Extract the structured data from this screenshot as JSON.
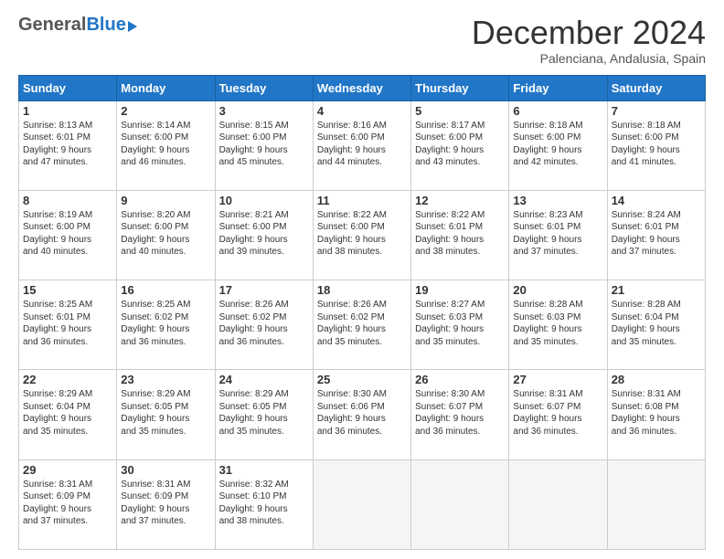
{
  "header": {
    "logo_general": "General",
    "logo_blue": "Blue",
    "title": "December 2024",
    "location": "Palenciana, Andalusia, Spain"
  },
  "days_of_week": [
    "Sunday",
    "Monday",
    "Tuesday",
    "Wednesday",
    "Thursday",
    "Friday",
    "Saturday"
  ],
  "weeks": [
    [
      {
        "day": "1",
        "lines": [
          "Sunrise: 8:13 AM",
          "Sunset: 6:01 PM",
          "Daylight: 9 hours",
          "and 47 minutes."
        ]
      },
      {
        "day": "2",
        "lines": [
          "Sunrise: 8:14 AM",
          "Sunset: 6:00 PM",
          "Daylight: 9 hours",
          "and 46 minutes."
        ]
      },
      {
        "day": "3",
        "lines": [
          "Sunrise: 8:15 AM",
          "Sunset: 6:00 PM",
          "Daylight: 9 hours",
          "and 45 minutes."
        ]
      },
      {
        "day": "4",
        "lines": [
          "Sunrise: 8:16 AM",
          "Sunset: 6:00 PM",
          "Daylight: 9 hours",
          "and 44 minutes."
        ]
      },
      {
        "day": "5",
        "lines": [
          "Sunrise: 8:17 AM",
          "Sunset: 6:00 PM",
          "Daylight: 9 hours",
          "and 43 minutes."
        ]
      },
      {
        "day": "6",
        "lines": [
          "Sunrise: 8:18 AM",
          "Sunset: 6:00 PM",
          "Daylight: 9 hours",
          "and 42 minutes."
        ]
      },
      {
        "day": "7",
        "lines": [
          "Sunrise: 8:18 AM",
          "Sunset: 6:00 PM",
          "Daylight: 9 hours",
          "and 41 minutes."
        ]
      }
    ],
    [
      {
        "day": "8",
        "lines": [
          "Sunrise: 8:19 AM",
          "Sunset: 6:00 PM",
          "Daylight: 9 hours",
          "and 40 minutes."
        ]
      },
      {
        "day": "9",
        "lines": [
          "Sunrise: 8:20 AM",
          "Sunset: 6:00 PM",
          "Daylight: 9 hours",
          "and 40 minutes."
        ]
      },
      {
        "day": "10",
        "lines": [
          "Sunrise: 8:21 AM",
          "Sunset: 6:00 PM",
          "Daylight: 9 hours",
          "and 39 minutes."
        ]
      },
      {
        "day": "11",
        "lines": [
          "Sunrise: 8:22 AM",
          "Sunset: 6:00 PM",
          "Daylight: 9 hours",
          "and 38 minutes."
        ]
      },
      {
        "day": "12",
        "lines": [
          "Sunrise: 8:22 AM",
          "Sunset: 6:01 PM",
          "Daylight: 9 hours",
          "and 38 minutes."
        ]
      },
      {
        "day": "13",
        "lines": [
          "Sunrise: 8:23 AM",
          "Sunset: 6:01 PM",
          "Daylight: 9 hours",
          "and 37 minutes."
        ]
      },
      {
        "day": "14",
        "lines": [
          "Sunrise: 8:24 AM",
          "Sunset: 6:01 PM",
          "Daylight: 9 hours",
          "and 37 minutes."
        ]
      }
    ],
    [
      {
        "day": "15",
        "lines": [
          "Sunrise: 8:25 AM",
          "Sunset: 6:01 PM",
          "Daylight: 9 hours",
          "and 36 minutes."
        ]
      },
      {
        "day": "16",
        "lines": [
          "Sunrise: 8:25 AM",
          "Sunset: 6:02 PM",
          "Daylight: 9 hours",
          "and 36 minutes."
        ]
      },
      {
        "day": "17",
        "lines": [
          "Sunrise: 8:26 AM",
          "Sunset: 6:02 PM",
          "Daylight: 9 hours",
          "and 36 minutes."
        ]
      },
      {
        "day": "18",
        "lines": [
          "Sunrise: 8:26 AM",
          "Sunset: 6:02 PM",
          "Daylight: 9 hours",
          "and 35 minutes."
        ]
      },
      {
        "day": "19",
        "lines": [
          "Sunrise: 8:27 AM",
          "Sunset: 6:03 PM",
          "Daylight: 9 hours",
          "and 35 minutes."
        ]
      },
      {
        "day": "20",
        "lines": [
          "Sunrise: 8:28 AM",
          "Sunset: 6:03 PM",
          "Daylight: 9 hours",
          "and 35 minutes."
        ]
      },
      {
        "day": "21",
        "lines": [
          "Sunrise: 8:28 AM",
          "Sunset: 6:04 PM",
          "Daylight: 9 hours",
          "and 35 minutes."
        ]
      }
    ],
    [
      {
        "day": "22",
        "lines": [
          "Sunrise: 8:29 AM",
          "Sunset: 6:04 PM",
          "Daylight: 9 hours",
          "and 35 minutes."
        ]
      },
      {
        "day": "23",
        "lines": [
          "Sunrise: 8:29 AM",
          "Sunset: 6:05 PM",
          "Daylight: 9 hours",
          "and 35 minutes."
        ]
      },
      {
        "day": "24",
        "lines": [
          "Sunrise: 8:29 AM",
          "Sunset: 6:05 PM",
          "Daylight: 9 hours",
          "and 35 minutes."
        ]
      },
      {
        "day": "25",
        "lines": [
          "Sunrise: 8:30 AM",
          "Sunset: 6:06 PM",
          "Daylight: 9 hours",
          "and 36 minutes."
        ]
      },
      {
        "day": "26",
        "lines": [
          "Sunrise: 8:30 AM",
          "Sunset: 6:07 PM",
          "Daylight: 9 hours",
          "and 36 minutes."
        ]
      },
      {
        "day": "27",
        "lines": [
          "Sunrise: 8:31 AM",
          "Sunset: 6:07 PM",
          "Daylight: 9 hours",
          "and 36 minutes."
        ]
      },
      {
        "day": "28",
        "lines": [
          "Sunrise: 8:31 AM",
          "Sunset: 6:08 PM",
          "Daylight: 9 hours",
          "and 36 minutes."
        ]
      }
    ],
    [
      {
        "day": "29",
        "lines": [
          "Sunrise: 8:31 AM",
          "Sunset: 6:09 PM",
          "Daylight: 9 hours",
          "and 37 minutes."
        ]
      },
      {
        "day": "30",
        "lines": [
          "Sunrise: 8:31 AM",
          "Sunset: 6:09 PM",
          "Daylight: 9 hours",
          "and 37 minutes."
        ]
      },
      {
        "day": "31",
        "lines": [
          "Sunrise: 8:32 AM",
          "Sunset: 6:10 PM",
          "Daylight: 9 hours",
          "and 38 minutes."
        ]
      },
      null,
      null,
      null,
      null
    ]
  ]
}
